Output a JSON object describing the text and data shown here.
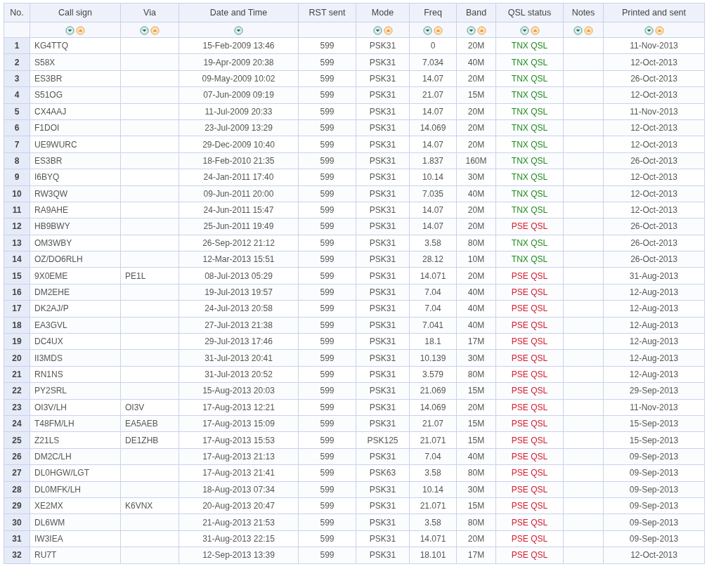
{
  "table": {
    "columns": [
      {
        "label": "No.",
        "sort_descending": false,
        "sort_ascending": false
      },
      {
        "label": "Call sign",
        "sort_descending": true,
        "sort_ascending": true
      },
      {
        "label": "Via",
        "sort_descending": true,
        "sort_ascending": true
      },
      {
        "label": "Date and Time",
        "sort_descending": true,
        "sort_ascending": false
      },
      {
        "label": "RST sent",
        "sort_descending": false,
        "sort_ascending": false
      },
      {
        "label": "Mode",
        "sort_descending": true,
        "sort_ascending": true
      },
      {
        "label": "Freq",
        "sort_descending": true,
        "sort_ascending": true
      },
      {
        "label": "Band",
        "sort_descending": true,
        "sort_ascending": true
      },
      {
        "label": "QSL status",
        "sort_descending": true,
        "sort_ascending": true
      },
      {
        "label": "Notes",
        "sort_descending": true,
        "sort_ascending": true
      },
      {
        "label": "Printed and sent",
        "sort_descending": true,
        "sort_ascending": true
      }
    ],
    "rows": [
      {
        "no": "1",
        "call": "KG4TTQ",
        "datetime": "15-Feb-2009 13:46",
        "rst": "599",
        "mode": "PSK31",
        "freq": "0",
        "band": "20M",
        "qsl": {
          "text": "TNX QSL",
          "kind": "received"
        },
        "printed": "11-Nov-2013"
      },
      {
        "no": "2",
        "call": "S58X",
        "datetime": "19-Apr-2009 20:38",
        "rst": "599",
        "mode": "PSK31",
        "freq": "7.034",
        "band": "40M",
        "qsl": {
          "text": "TNX QSL",
          "kind": "received"
        },
        "printed": "12-Oct-2013"
      },
      {
        "no": "3",
        "call": "ES3BR",
        "datetime": "09-May-2009 10:02",
        "rst": "599",
        "mode": "PSK31",
        "freq": "14.07",
        "band": "20M",
        "qsl": {
          "text": "TNX QSL",
          "kind": "received"
        },
        "printed": "26-Oct-2013"
      },
      {
        "no": "4",
        "call": "S51OG",
        "datetime": "07-Jun-2009 09:19",
        "rst": "599",
        "mode": "PSK31",
        "freq": "21.07",
        "band": "15M",
        "qsl": {
          "text": "TNX QSL",
          "kind": "received"
        },
        "printed": "12-Oct-2013"
      },
      {
        "no": "5",
        "call": "CX4AAJ",
        "datetime": "11-Jul-2009 20:33",
        "rst": "599",
        "mode": "PSK31",
        "freq": "14.07",
        "band": "20M",
        "qsl": {
          "text": "TNX QSL",
          "kind": "received"
        },
        "printed": "11-Nov-2013"
      },
      {
        "no": "6",
        "call": "F1DOI",
        "datetime": "23-Jul-2009 13:29",
        "rst": "599",
        "mode": "PSK31",
        "freq": "14.069",
        "band": "20M",
        "qsl": {
          "text": "TNX QSL",
          "kind": "received"
        },
        "printed": "12-Oct-2013"
      },
      {
        "no": "7",
        "call": "UE9WURC",
        "datetime": "29-Dec-2009 10:40",
        "rst": "599",
        "mode": "PSK31",
        "freq": "14.07",
        "band": "20M",
        "qsl": {
          "text": "TNX QSL",
          "kind": "received"
        },
        "printed": "12-Oct-2013"
      },
      {
        "no": "8",
        "call": "ES3BR",
        "datetime": "18-Feb-2010 21:35",
        "rst": "599",
        "mode": "PSK31",
        "freq": "1.837",
        "band": "160M",
        "qsl": {
          "text": "TNX QSL",
          "kind": "received"
        },
        "printed": "26-Oct-2013"
      },
      {
        "no": "9",
        "call": "I6BYQ",
        "datetime": "24-Jan-2011 17:40",
        "rst": "599",
        "mode": "PSK31",
        "freq": "10.14",
        "band": "30M",
        "qsl": {
          "text": "TNX QSL",
          "kind": "received"
        },
        "printed": "12-Oct-2013"
      },
      {
        "no": "10",
        "call": "RW3QW",
        "datetime": "09-Jun-2011 20:00",
        "rst": "599",
        "mode": "PSK31",
        "freq": "7.035",
        "band": "40M",
        "qsl": {
          "text": "TNX QSL",
          "kind": "received"
        },
        "printed": "12-Oct-2013"
      },
      {
        "no": "11",
        "call": "RA9AHE",
        "datetime": "24-Jun-2011 15:47",
        "rst": "599",
        "mode": "PSK31",
        "freq": "14.07",
        "band": "20M",
        "qsl": {
          "text": "TNX QSL",
          "kind": "received"
        },
        "printed": "12-Oct-2013"
      },
      {
        "no": "12",
        "call": "HB9BWY",
        "datetime": "25-Jun-2011 19:49",
        "rst": "599",
        "mode": "PSK31",
        "freq": "14.07",
        "band": "20M",
        "qsl": {
          "text": "PSE QSL",
          "kind": "requested"
        },
        "printed": "26-Oct-2013"
      },
      {
        "no": "13",
        "call": "OM3WBY",
        "datetime": "26-Sep-2012 21:12",
        "rst": "599",
        "mode": "PSK31",
        "freq": "3.58",
        "band": "80M",
        "qsl": {
          "text": "TNX QSL",
          "kind": "received"
        },
        "printed": "26-Oct-2013"
      },
      {
        "no": "14",
        "call": "OZ/DO6RLH",
        "datetime": "12-Mar-2013 15:51",
        "rst": "599",
        "mode": "PSK31",
        "freq": "28.12",
        "band": "10M",
        "qsl": {
          "text": "TNX QSL",
          "kind": "received"
        },
        "printed": "26-Oct-2013"
      },
      {
        "no": "15",
        "call": "9X0EME",
        "via": "PE1L",
        "datetime": "08-Jul-2013 05:29",
        "rst": "599",
        "mode": "PSK31",
        "freq": "14.071",
        "band": "20M",
        "qsl": {
          "text": "PSE QSL",
          "kind": "requested"
        },
        "printed": "31-Aug-2013"
      },
      {
        "no": "16",
        "call": "DM2EHE",
        "datetime": "19-Jul-2013 19:57",
        "rst": "599",
        "mode": "PSK31",
        "freq": "7.04",
        "band": "40M",
        "qsl": {
          "text": "PSE QSL",
          "kind": "requested"
        },
        "printed": "12-Aug-2013"
      },
      {
        "no": "17",
        "call": "DK2AJ/P",
        "datetime": "24-Jul-2013 20:58",
        "rst": "599",
        "mode": "PSK31",
        "freq": "7.04",
        "band": "40M",
        "qsl": {
          "text": "PSE QSL",
          "kind": "requested"
        },
        "printed": "12-Aug-2013"
      },
      {
        "no": "18",
        "call": "EA3GVL",
        "datetime": "27-Jul-2013 21:38",
        "rst": "599",
        "mode": "PSK31",
        "freq": "7.041",
        "band": "40M",
        "qsl": {
          "text": "PSE QSL",
          "kind": "requested"
        },
        "printed": "12-Aug-2013"
      },
      {
        "no": "19",
        "call": "DC4UX",
        "datetime": "29-Jul-2013 17:46",
        "rst": "599",
        "mode": "PSK31",
        "freq": "18.1",
        "band": "17M",
        "qsl": {
          "text": "PSE QSL",
          "kind": "requested"
        },
        "printed": "12-Aug-2013"
      },
      {
        "no": "20",
        "call": "II3MDS",
        "datetime": "31-Jul-2013 20:41",
        "rst": "599",
        "mode": "PSK31",
        "freq": "10.139",
        "band": "30M",
        "qsl": {
          "text": "PSE QSL",
          "kind": "requested"
        },
        "printed": "12-Aug-2013"
      },
      {
        "no": "21",
        "call": "RN1NS",
        "datetime": "31-Jul-2013 20:52",
        "rst": "599",
        "mode": "PSK31",
        "freq": "3.579",
        "band": "80M",
        "qsl": {
          "text": "PSE QSL",
          "kind": "requested"
        },
        "printed": "12-Aug-2013"
      },
      {
        "no": "22",
        "call": "PY2SRL",
        "datetime": "15-Aug-2013 20:03",
        "rst": "599",
        "mode": "PSK31",
        "freq": "21.069",
        "band": "15M",
        "qsl": {
          "text": "PSE QSL",
          "kind": "requested"
        },
        "printed": "29-Sep-2013"
      },
      {
        "no": "23",
        "call": "OI3V/LH",
        "via": "OI3V",
        "datetime": "17-Aug-2013 12:21",
        "rst": "599",
        "mode": "PSK31",
        "freq": "14.069",
        "band": "20M",
        "qsl": {
          "text": "PSE QSL",
          "kind": "requested"
        },
        "printed": "11-Nov-2013"
      },
      {
        "no": "24",
        "call": "T48FM/LH",
        "via": "EA5AEB",
        "datetime": "17-Aug-2013 15:09",
        "rst": "599",
        "mode": "PSK31",
        "freq": "21.07",
        "band": "15M",
        "qsl": {
          "text": "PSE QSL",
          "kind": "requested"
        },
        "printed": "15-Sep-2013"
      },
      {
        "no": "25",
        "call": "Z21LS",
        "via": "DE1ZHB",
        "datetime": "17-Aug-2013 15:53",
        "rst": "599",
        "mode": "PSK125",
        "freq": "21.071",
        "band": "15M",
        "qsl": {
          "text": "PSE QSL",
          "kind": "requested"
        },
        "printed": "15-Sep-2013"
      },
      {
        "no": "26",
        "call": "DM2C/LH",
        "datetime": "17-Aug-2013 21:13",
        "rst": "599",
        "mode": "PSK31",
        "freq": "7.04",
        "band": "40M",
        "qsl": {
          "text": "PSE QSL",
          "kind": "requested"
        },
        "printed": "09-Sep-2013"
      },
      {
        "no": "27",
        "call": "DL0HGW/LGT",
        "datetime": "17-Aug-2013 21:41",
        "rst": "599",
        "mode": "PSK63",
        "freq": "3.58",
        "band": "80M",
        "qsl": {
          "text": "PSE QSL",
          "kind": "requested"
        },
        "printed": "09-Sep-2013"
      },
      {
        "no": "28",
        "call": "DL0MFK/LH",
        "datetime": "18-Aug-2013 07:34",
        "rst": "599",
        "mode": "PSK31",
        "freq": "10.14",
        "band": "30M",
        "qsl": {
          "text": "PSE QSL",
          "kind": "requested"
        },
        "printed": "09-Sep-2013"
      },
      {
        "no": "29",
        "call": "XE2MX",
        "via": "K6VNX",
        "datetime": "20-Aug-2013 20:47",
        "rst": "599",
        "mode": "PSK31",
        "freq": "21.071",
        "band": "15M",
        "qsl": {
          "text": "PSE QSL",
          "kind": "requested"
        },
        "printed": "09-Sep-2013"
      },
      {
        "no": "30",
        "call": "DL6WM",
        "datetime": "21-Aug-2013 21:53",
        "rst": "599",
        "mode": "PSK31",
        "freq": "3.58",
        "band": "80M",
        "qsl": {
          "text": "PSE QSL",
          "kind": "requested"
        },
        "printed": "09-Sep-2013"
      },
      {
        "no": "31",
        "call": "IW3IEA",
        "datetime": "31-Aug-2013 22:15",
        "rst": "599",
        "mode": "PSK31",
        "freq": "14.071",
        "band": "20M",
        "qsl": {
          "text": "PSE QSL",
          "kind": "requested"
        },
        "printed": "09-Sep-2013"
      },
      {
        "no": "32",
        "call": "RU7T",
        "datetime": "12-Sep-2013 13:39",
        "rst": "599",
        "mode": "PSK31",
        "freq": "18.101",
        "band": "17M",
        "qsl": {
          "text": "PSE QSL",
          "kind": "requested"
        },
        "printed": "12-Oct-2013"
      }
    ]
  }
}
